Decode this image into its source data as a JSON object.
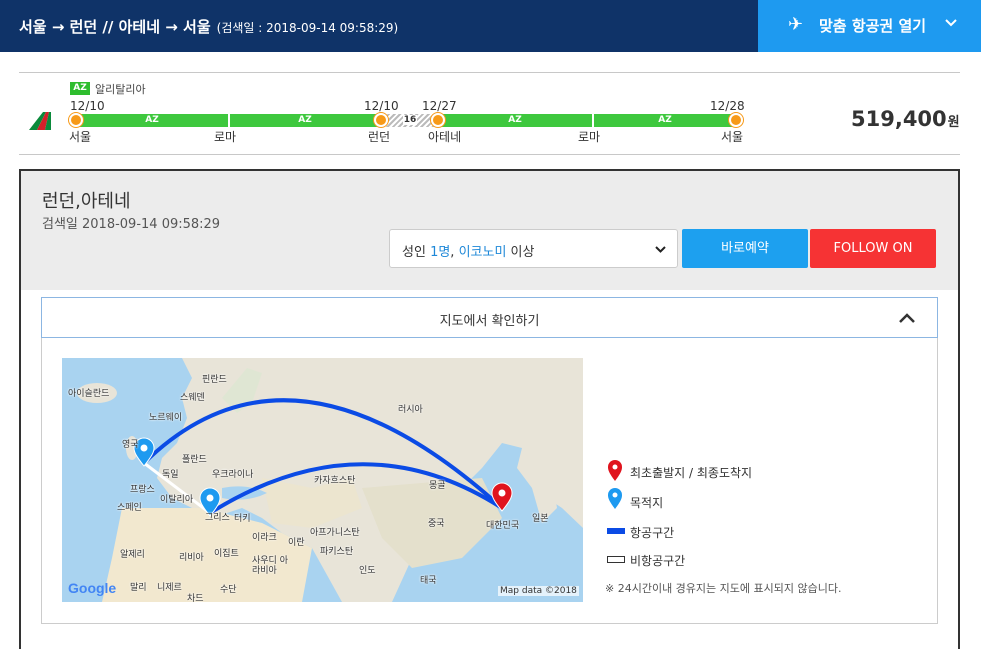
{
  "header": {
    "route": "서울 → 런던 // 아테네 → 서울",
    "searched": "(검색일 : 2018-09-14 09:58:29)",
    "open_label": "맞춤 항공권 열기",
    "accent": "#1e9af0",
    "bg": "#0f3368"
  },
  "itinerary": {
    "airline_code": "AZ",
    "airline_name": "알리탈리아",
    "price": "519,400",
    "currency": "원",
    "dates": [
      "12/10",
      "12/10",
      "12/27",
      "12/28"
    ],
    "cities": [
      "서울",
      "로마",
      "런던",
      "아테네",
      "로마",
      "서울"
    ],
    "segments": [
      "AZ",
      "AZ",
      "AZ",
      "AZ"
    ],
    "layover_days": "16"
  },
  "detail": {
    "destination": "런던,아테네",
    "searched": "검색일 2018-09-14 09:58:29",
    "pax_prefix": "성인 ",
    "pax_count": "1명",
    "pax_sep": ", ",
    "cabin": "이코노미",
    "cabin_suffix": " 이상",
    "book_label": "바로예약",
    "follow_label": "FOLLOW ON",
    "map_toggle_label": "지도에서 확인하기"
  },
  "map": {
    "labels": [
      "아이슬란드",
      "핀란드",
      "스웨덴",
      "노르웨이",
      "영국",
      "폴란드",
      "독일",
      "우크라이나",
      "프랑스",
      "이탈리아",
      "스페인",
      "그리스",
      "터키",
      "카자흐스탄",
      "몽골",
      "러시아",
      "이라크",
      "이란",
      "아프가니스탄",
      "파키스탄",
      "중국",
      "대한민국",
      "일본",
      "알제리",
      "리비아",
      "이집트",
      "사우디 아라비아",
      "인도",
      "말리",
      "니제르",
      "차드",
      "수단",
      "태국"
    ],
    "google": "Google",
    "attribution": "Map data ©2018"
  },
  "legend": {
    "origin": "최초출발지 / 최종도착지",
    "destination": "목적지",
    "flight": "항공구간",
    "surface": "비항공구간",
    "note": "※ 24시간이내 경유지는 지도에 표시되지 않습니다."
  }
}
